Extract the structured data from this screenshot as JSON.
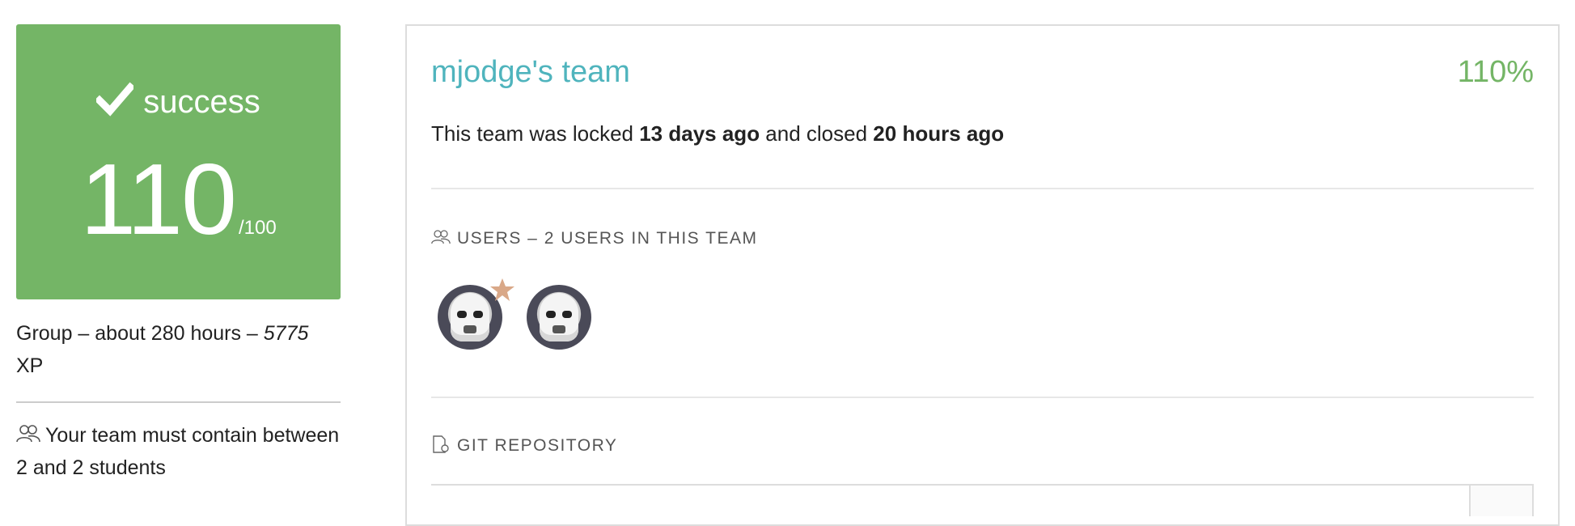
{
  "status": {
    "label": "success",
    "score": "110",
    "score_max": "/100"
  },
  "project_meta": {
    "text": "Group – about 280 hours – ",
    "xp": "5775",
    "xp_unit": " XP"
  },
  "team_rule": "Your team must contain between 2 and 2 students",
  "team": {
    "title": "mjodge's team",
    "percent": "110%",
    "lock_prefix": "This team was locked ",
    "locked_ago": "13 days ago",
    "lock_middle": " and closed ",
    "closed_ago": "20 hours ago"
  },
  "users_section": {
    "label": "USERS – 2 USERS IN THIS TEAM",
    "users": [
      {
        "avatar": "stormtrooper",
        "leader": true
      },
      {
        "avatar": "stormtrooper",
        "leader": false
      }
    ]
  },
  "git_section": {
    "label": "GIT REPOSITORY"
  },
  "colors": {
    "success": "#74b566",
    "title": "#4fb4bd",
    "leader_star": "#d9a888"
  },
  "icons": [
    "check-icon",
    "users-icon",
    "git-file-icon",
    "star-icon"
  ]
}
